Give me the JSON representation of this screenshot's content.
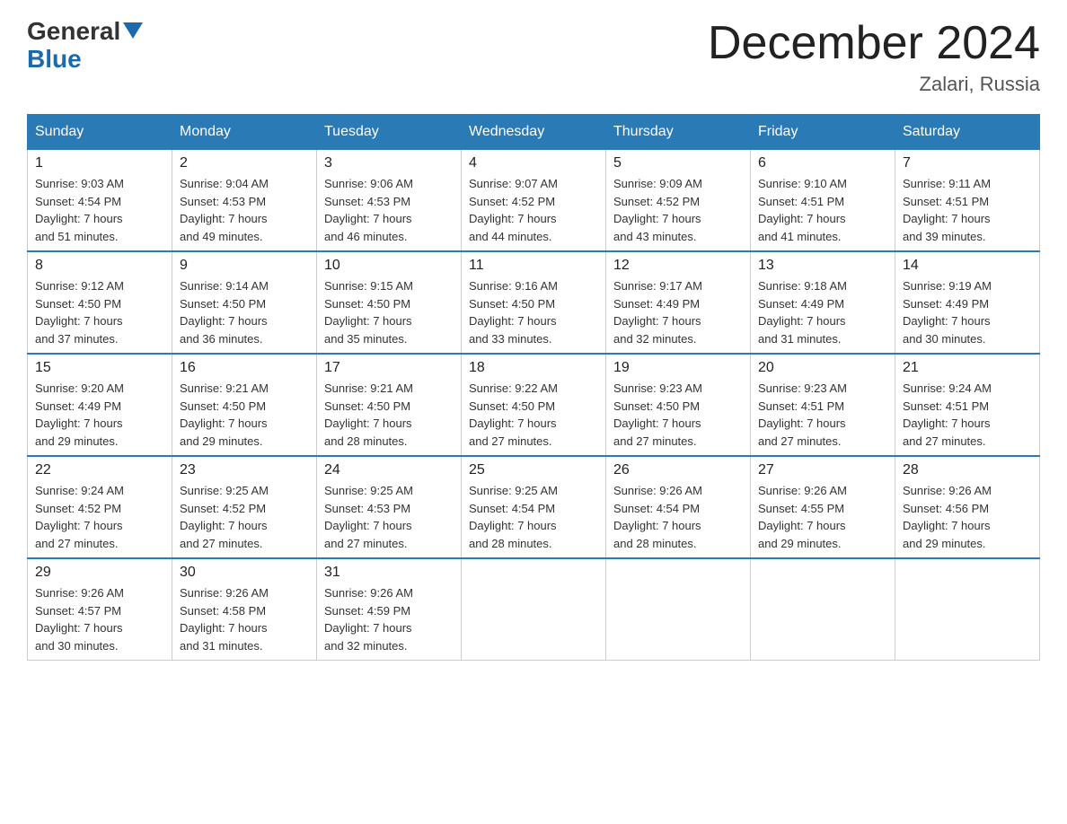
{
  "header": {
    "logo": {
      "general": "General",
      "blue": "Blue"
    },
    "title": "December 2024",
    "location": "Zalari, Russia"
  },
  "calendar": {
    "days_of_week": [
      "Sunday",
      "Monday",
      "Tuesday",
      "Wednesday",
      "Thursday",
      "Friday",
      "Saturday"
    ],
    "weeks": [
      [
        {
          "day": "1",
          "sunrise": "9:03 AM",
          "sunset": "4:54 PM",
          "daylight": "7 hours and 51 minutes."
        },
        {
          "day": "2",
          "sunrise": "9:04 AM",
          "sunset": "4:53 PM",
          "daylight": "7 hours and 49 minutes."
        },
        {
          "day": "3",
          "sunrise": "9:06 AM",
          "sunset": "4:53 PM",
          "daylight": "7 hours and 46 minutes."
        },
        {
          "day": "4",
          "sunrise": "9:07 AM",
          "sunset": "4:52 PM",
          "daylight": "7 hours and 44 minutes."
        },
        {
          "day": "5",
          "sunrise": "9:09 AM",
          "sunset": "4:52 PM",
          "daylight": "7 hours and 43 minutes."
        },
        {
          "day": "6",
          "sunrise": "9:10 AM",
          "sunset": "4:51 PM",
          "daylight": "7 hours and 41 minutes."
        },
        {
          "day": "7",
          "sunrise": "9:11 AM",
          "sunset": "4:51 PM",
          "daylight": "7 hours and 39 minutes."
        }
      ],
      [
        {
          "day": "8",
          "sunrise": "9:12 AM",
          "sunset": "4:50 PM",
          "daylight": "7 hours and 37 minutes."
        },
        {
          "day": "9",
          "sunrise": "9:14 AM",
          "sunset": "4:50 PM",
          "daylight": "7 hours and 36 minutes."
        },
        {
          "day": "10",
          "sunrise": "9:15 AM",
          "sunset": "4:50 PM",
          "daylight": "7 hours and 35 minutes."
        },
        {
          "day": "11",
          "sunrise": "9:16 AM",
          "sunset": "4:50 PM",
          "daylight": "7 hours and 33 minutes."
        },
        {
          "day": "12",
          "sunrise": "9:17 AM",
          "sunset": "4:49 PM",
          "daylight": "7 hours and 32 minutes."
        },
        {
          "day": "13",
          "sunrise": "9:18 AM",
          "sunset": "4:49 PM",
          "daylight": "7 hours and 31 minutes."
        },
        {
          "day": "14",
          "sunrise": "9:19 AM",
          "sunset": "4:49 PM",
          "daylight": "7 hours and 30 minutes."
        }
      ],
      [
        {
          "day": "15",
          "sunrise": "9:20 AM",
          "sunset": "4:49 PM",
          "daylight": "7 hours and 29 minutes."
        },
        {
          "day": "16",
          "sunrise": "9:21 AM",
          "sunset": "4:50 PM",
          "daylight": "7 hours and 29 minutes."
        },
        {
          "day": "17",
          "sunrise": "9:21 AM",
          "sunset": "4:50 PM",
          "daylight": "7 hours and 28 minutes."
        },
        {
          "day": "18",
          "sunrise": "9:22 AM",
          "sunset": "4:50 PM",
          "daylight": "7 hours and 27 minutes."
        },
        {
          "day": "19",
          "sunrise": "9:23 AM",
          "sunset": "4:50 PM",
          "daylight": "7 hours and 27 minutes."
        },
        {
          "day": "20",
          "sunrise": "9:23 AM",
          "sunset": "4:51 PM",
          "daylight": "7 hours and 27 minutes."
        },
        {
          "day": "21",
          "sunrise": "9:24 AM",
          "sunset": "4:51 PM",
          "daylight": "7 hours and 27 minutes."
        }
      ],
      [
        {
          "day": "22",
          "sunrise": "9:24 AM",
          "sunset": "4:52 PM",
          "daylight": "7 hours and 27 minutes."
        },
        {
          "day": "23",
          "sunrise": "9:25 AM",
          "sunset": "4:52 PM",
          "daylight": "7 hours and 27 minutes."
        },
        {
          "day": "24",
          "sunrise": "9:25 AM",
          "sunset": "4:53 PM",
          "daylight": "7 hours and 27 minutes."
        },
        {
          "day": "25",
          "sunrise": "9:25 AM",
          "sunset": "4:54 PM",
          "daylight": "7 hours and 28 minutes."
        },
        {
          "day": "26",
          "sunrise": "9:26 AM",
          "sunset": "4:54 PM",
          "daylight": "7 hours and 28 minutes."
        },
        {
          "day": "27",
          "sunrise": "9:26 AM",
          "sunset": "4:55 PM",
          "daylight": "7 hours and 29 minutes."
        },
        {
          "day": "28",
          "sunrise": "9:26 AM",
          "sunset": "4:56 PM",
          "daylight": "7 hours and 29 minutes."
        }
      ],
      [
        {
          "day": "29",
          "sunrise": "9:26 AM",
          "sunset": "4:57 PM",
          "daylight": "7 hours and 30 minutes."
        },
        {
          "day": "30",
          "sunrise": "9:26 AM",
          "sunset": "4:58 PM",
          "daylight": "7 hours and 31 minutes."
        },
        {
          "day": "31",
          "sunrise": "9:26 AM",
          "sunset": "4:59 PM",
          "daylight": "7 hours and 32 minutes."
        },
        null,
        null,
        null,
        null
      ]
    ]
  }
}
